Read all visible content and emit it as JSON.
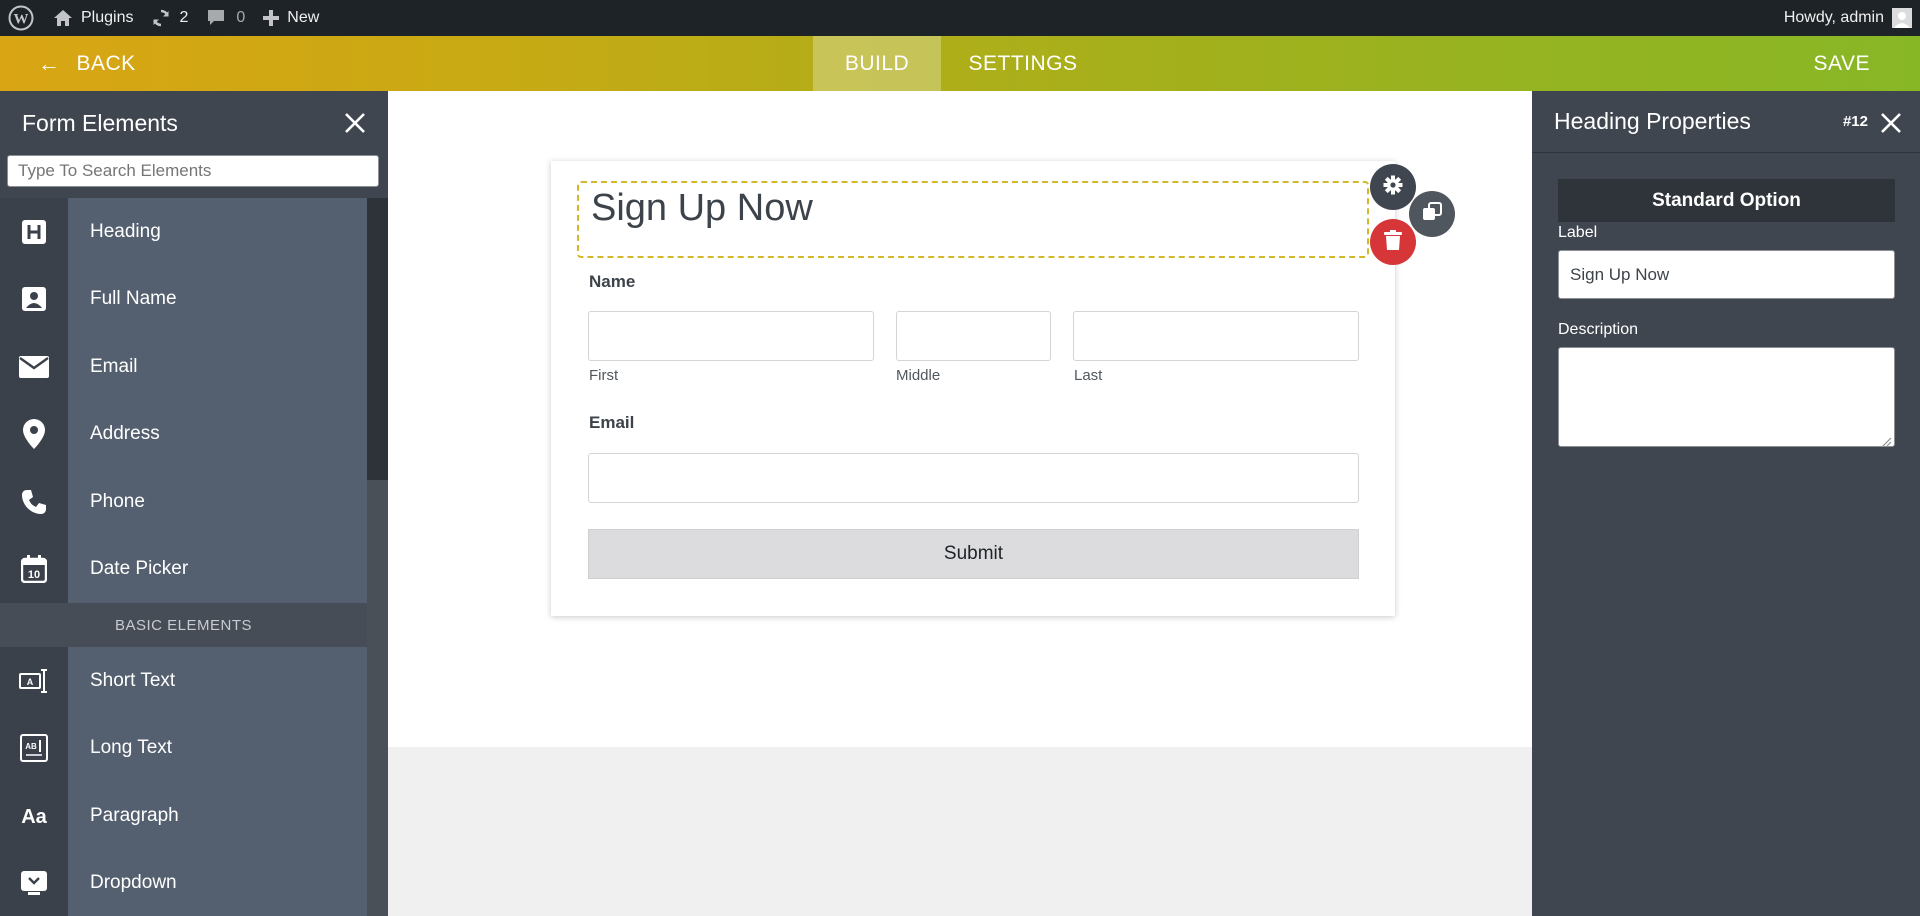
{
  "admin_bar": {
    "site_name": "Plugins",
    "updates_count": "2",
    "comments_count": "0",
    "new_label": "New",
    "howdy": "Howdy, admin"
  },
  "topbar": {
    "back_label": "BACK",
    "tabs": [
      {
        "label": "BUILD",
        "active": true
      },
      {
        "label": "SETTINGS",
        "active": false
      }
    ],
    "save_label": "SAVE",
    "gradient_colors": [
      "#d9a514",
      "#88b726"
    ]
  },
  "left_panel": {
    "title": "Form Elements",
    "search_placeholder": "Type To Search Elements",
    "items": [
      {
        "label": "Heading",
        "icon": "heading-icon"
      },
      {
        "label": "Full Name",
        "icon": "user-card-icon"
      },
      {
        "label": "Email",
        "icon": "envelope-icon"
      },
      {
        "label": "Address",
        "icon": "map-marker-icon"
      },
      {
        "label": "Phone",
        "icon": "phone-icon"
      },
      {
        "label": "Date Picker",
        "icon": "calendar-icon"
      }
    ],
    "group_label": "BASIC ELEMENTS",
    "basic_items": [
      {
        "label": "Short Text",
        "icon": "short-text-icon"
      },
      {
        "label": "Long Text",
        "icon": "long-text-icon"
      },
      {
        "label": "Paragraph",
        "icon": "paragraph-icon"
      },
      {
        "label": "Dropdown",
        "icon": "dropdown-icon"
      }
    ]
  },
  "form": {
    "heading": "Sign Up Now",
    "name_label": "Name",
    "name_sublabels": {
      "first": "First",
      "middle": "Middle",
      "last": "Last"
    },
    "email_label": "Email",
    "submit_label": "Submit",
    "accent_color": "#d4b82c",
    "delete_color": "#d63638"
  },
  "right_panel": {
    "title": "Heading Properties",
    "element_id": "#12",
    "section_title": "Standard Option",
    "label_caption": "Label",
    "label_value": "Sign Up Now",
    "description_caption": "Description",
    "description_value": ""
  }
}
